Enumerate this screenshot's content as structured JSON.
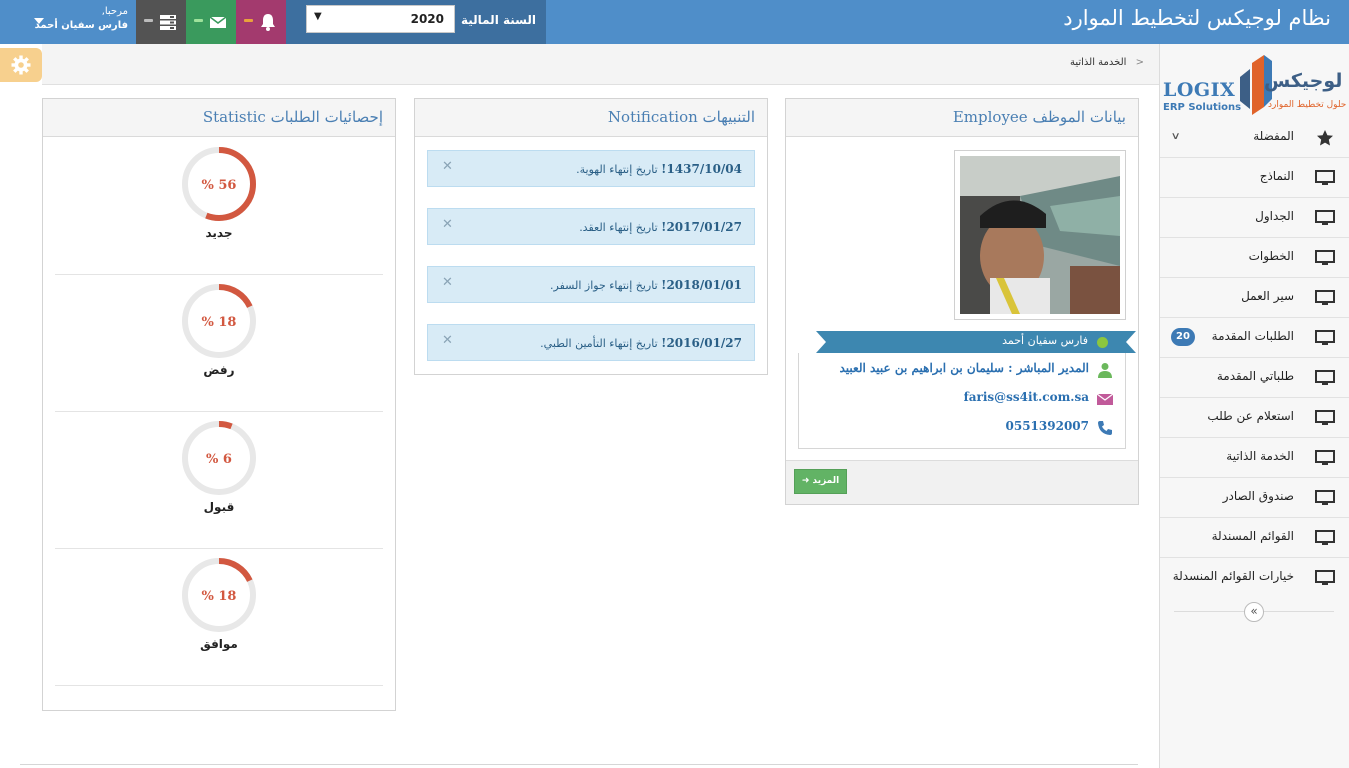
{
  "header": {
    "app_title": "نظام لوجيكس لتخطيط الموارد",
    "fiscal_year_label": "السنة المالية",
    "fiscal_year_value": "2020",
    "user_greeting": "مرحبا,",
    "user_name": "فارس سفيان أحمد",
    "colors": {
      "bar": "#4f8ec9",
      "notifications": "#a33a6e",
      "messages": "#3a9a5d",
      "tasks": "#535353"
    }
  },
  "logo": {
    "arabic": "لوجيكس",
    "arabic_tagline": "حلول تخطيط الموارد",
    "english": "LOGIX",
    "english_tagline": "ERP Solutions"
  },
  "sidebar": {
    "items": [
      {
        "label": "المفضلة",
        "icon": "star-icon"
      },
      {
        "label": "النماذج",
        "icon": "monitor-icon"
      },
      {
        "label": "الجداول",
        "icon": "monitor-icon"
      },
      {
        "label": "الخطوات",
        "icon": "monitor-icon"
      },
      {
        "label": "سير العمل",
        "icon": "monitor-icon"
      },
      {
        "label": "الطلبات المقدمة",
        "icon": "monitor-icon",
        "badge": "20"
      },
      {
        "label": "طلباتي المقدمة",
        "icon": "monitor-icon"
      },
      {
        "label": "استعلام عن طلب",
        "icon": "monitor-icon"
      },
      {
        "label": "الخدمة الذاتية",
        "icon": "monitor-icon"
      },
      {
        "label": "صندوق الصادر",
        "icon": "monitor-icon"
      },
      {
        "label": "القوائم المسندلة",
        "icon": "monitor-icon"
      },
      {
        "label": "خيارات القوائم المنسدلة",
        "icon": "monitor-icon"
      }
    ]
  },
  "breadcrumb": {
    "current": "الخدمة الذاتية"
  },
  "employee": {
    "title": "بيانات الموظف Employee",
    "name": "فارس سفيان أحمد",
    "manager": "المدير المباشر : سليمان بن ابراهيم بن عبيد العبيد",
    "email": "faris@ss4it.com.sa",
    "phone": "0551392007",
    "more_label": "المزيد"
  },
  "notifications": {
    "title": "التنبيهات Notification",
    "items": [
      {
        "date": "1437/10/04!",
        "text": " تاريخ إنتهاء الهوية."
      },
      {
        "date": "2017/01/27!",
        "text": " تاريخ إنتهاء العقد."
      },
      {
        "date": "2018/01/01!",
        "text": " تاريخ إنتهاء جواز السفر."
      },
      {
        "date": "2016/01/27!",
        "text": " تاريخ إنتهاء التأمين الطبي."
      }
    ]
  },
  "statistics": {
    "title": "إحصائيات الطلبات Statistic",
    "ring_color": "#d25840",
    "track_color": "#e8e8e8",
    "items": [
      {
        "label": "جديد",
        "percent": 56,
        "percent_text": "% 56"
      },
      {
        "label": "رفض",
        "percent": 18,
        "percent_text": "% 18"
      },
      {
        "label": "قبول",
        "percent": 6,
        "percent_text": "% 6"
      },
      {
        "label": "موافق",
        "percent": 18,
        "percent_text": "% 18"
      }
    ]
  }
}
